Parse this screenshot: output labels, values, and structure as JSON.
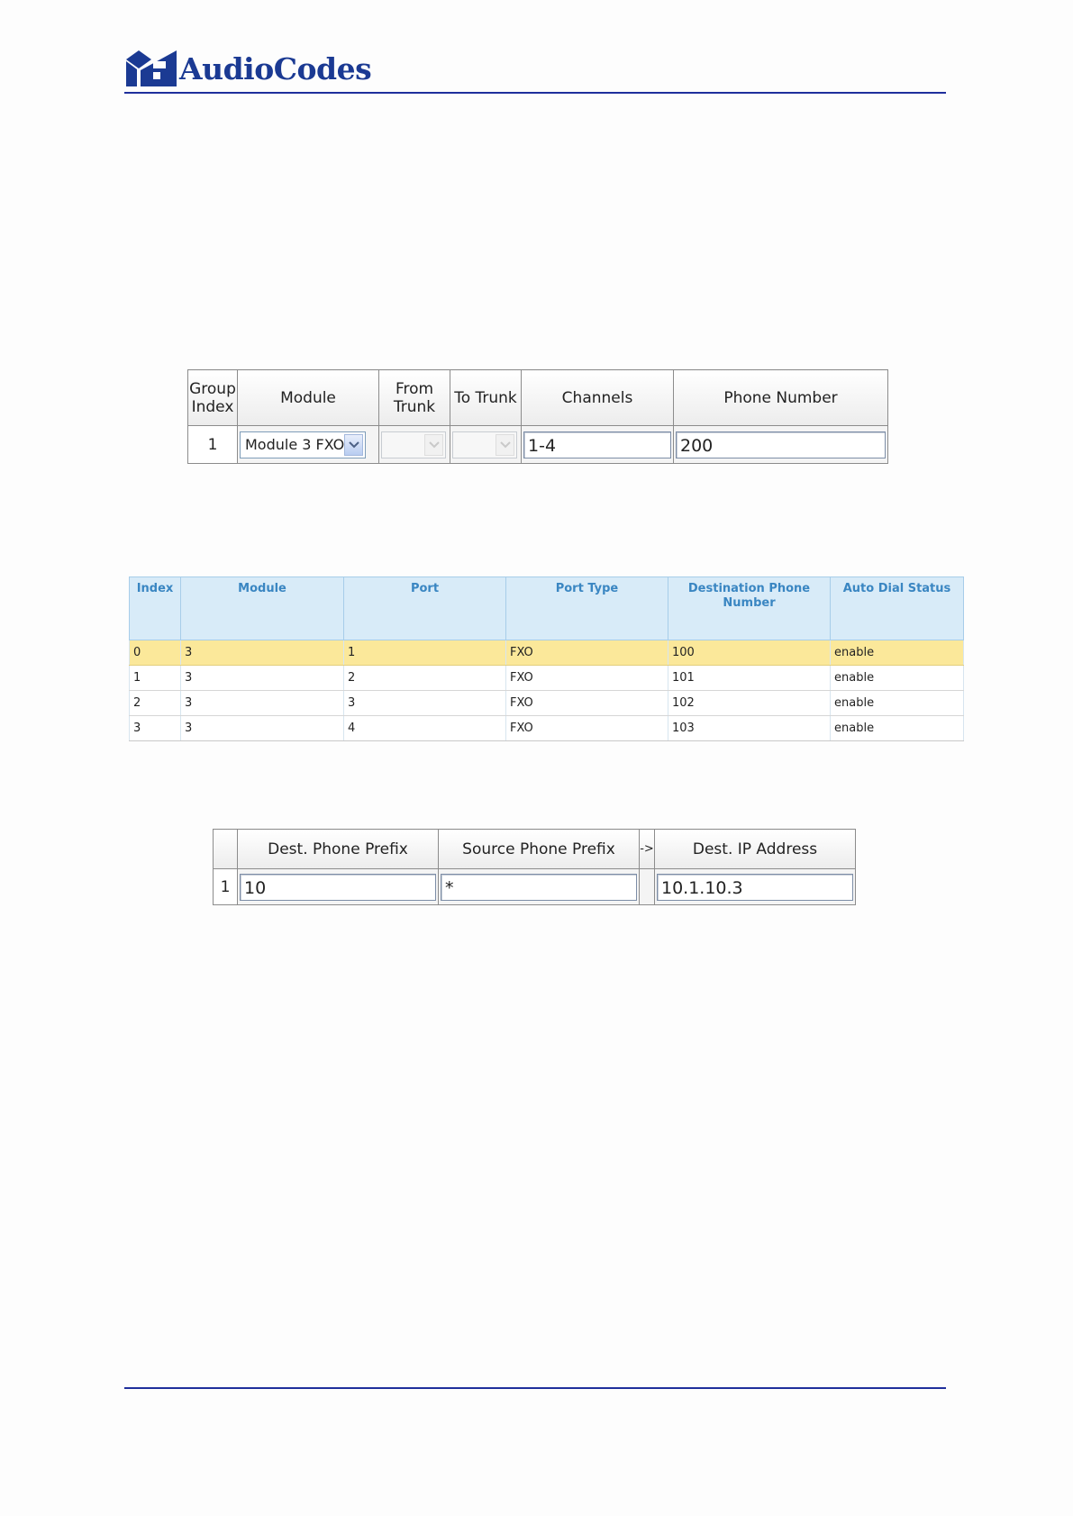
{
  "header": {
    "brand": "AudioCodes"
  },
  "trunk_group": {
    "headers": [
      "Group Index",
      "Module",
      "From Trunk",
      "To Trunk",
      "Channels",
      "Phone Number"
    ],
    "row": {
      "index": "1",
      "module": "Module 3 FXO",
      "from_trunk": "",
      "to_trunk": "",
      "channels": "1-4",
      "phone_number": "200"
    }
  },
  "auto_dial": {
    "headers": [
      "Index",
      "Module",
      "Port",
      "Port Type",
      "Destination Phone Number",
      "Auto Dial Status"
    ],
    "rows": [
      [
        "0",
        "3",
        "1",
        "FXO",
        "100",
        "enable"
      ],
      [
        "1",
        "3",
        "2",
        "FXO",
        "101",
        "enable"
      ],
      [
        "2",
        "3",
        "3",
        "FXO",
        "102",
        "enable"
      ],
      [
        "3",
        "3",
        "4",
        "FXO",
        "103",
        "enable"
      ]
    ],
    "selected_row": 0
  },
  "routing": {
    "headers": [
      "",
      "Dest. Phone Prefix",
      "Source Phone Prefix",
      "->",
      "Dest. IP Address"
    ],
    "row": {
      "index": "1",
      "dest_prefix": "10",
      "source_prefix": "*",
      "dest_ip": "10.1.10.3"
    }
  },
  "colors": {
    "brand_blue": "#1b3a93",
    "rule_blue": "#1f2f9c",
    "highlight_row": "#fbe89a",
    "status_header_bg": "#d8ebf8",
    "status_header_text": "#3a86c2"
  },
  "icons": [
    "audiocodes-logo-icon",
    "chevron-down-icon"
  ]
}
